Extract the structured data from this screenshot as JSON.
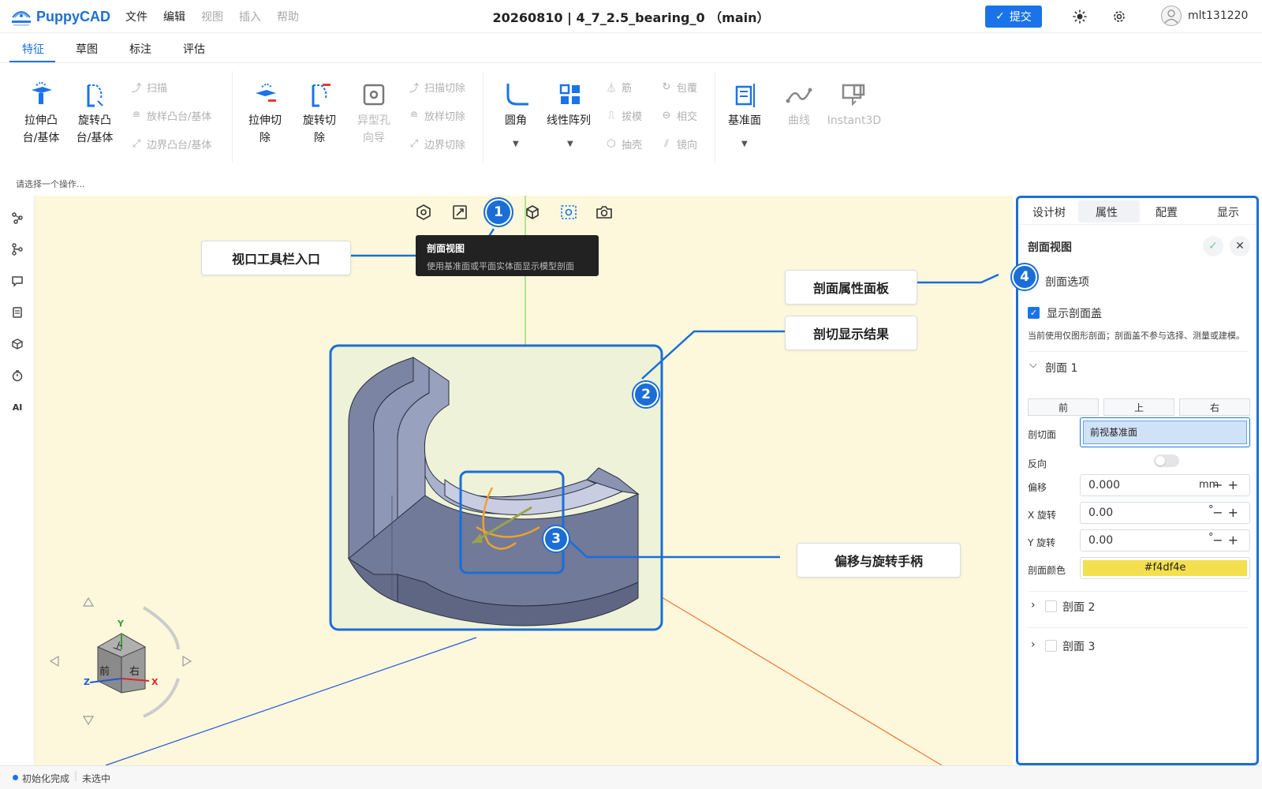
{
  "app": {
    "name": "PuppyCAD",
    "document_title": "20260810 | 4_7_2.5_bearing_0 （main）"
  },
  "menu": [
    {
      "label": "文件",
      "enabled": true
    },
    {
      "label": "编辑",
      "enabled": true
    },
    {
      "label": "视图",
      "enabled": false
    },
    {
      "label": "插入",
      "enabled": false
    },
    {
      "label": "帮助",
      "enabled": false
    }
  ],
  "header": {
    "submit_label": "提交",
    "username": "mlt131220",
    "icons": [
      "sun-icon",
      "gear-icon",
      "avatar-icon"
    ]
  },
  "tabs": [
    {
      "label": "特征",
      "active": true
    },
    {
      "label": "草图",
      "active": false
    },
    {
      "label": "标注",
      "active": false
    },
    {
      "label": "评估",
      "active": false
    }
  ],
  "ribbon": {
    "extrude_boss": "拉伸凸\n台/基体",
    "extrude_boss_l1": "拉伸凸",
    "extrude_boss_l2": "台/基体",
    "revolve_boss_l1": "旋转凸",
    "revolve_boss_l2": "台/基体",
    "sweep": "扫描",
    "loft_boss": "放样凸台/基体",
    "boundary_boss": "边界凸台/基体",
    "extrude_cut_l1": "拉伸切",
    "extrude_cut_l2": "除",
    "revolve_cut_l1": "旋转切",
    "revolve_cut_l2": "除",
    "hole_wizard_l1": "异型孔",
    "hole_wizard_l2": "向导",
    "sweep_cut": "扫描切除",
    "loft_cut": "放样切除",
    "boundary_cut": "边界切除",
    "fillet": "圆角",
    "linear_pattern": "线性阵列",
    "rib": "筋",
    "draft": "拔模",
    "shell": "抽壳",
    "wrap": "包覆",
    "intersect": "相交",
    "mirror": "镜向",
    "ref_plane": "基准面",
    "curve": "曲线",
    "instant3d": "Instant3D"
  },
  "hint": "请选择一个操作...",
  "left_sidebar": {
    "icons": [
      "feature-tree-icon",
      "branch-icon",
      "comment-icon",
      "document-list-icon",
      "cube-icon",
      "timer-icon",
      "ai-icon"
    ],
    "ai_label": "AI"
  },
  "viewport_toolbar": {
    "icons": [
      "display-style-icon",
      "fit-view-icon",
      "section-view-icon",
      "view-cube-icon",
      "screenshot-region-icon",
      "camera-icon"
    ]
  },
  "tooltip": {
    "title": "剖面视图",
    "desc": "使用基准面或平面实体面显示模型剖面"
  },
  "callouts": {
    "c1_label": "视口工具栏入口",
    "c1_num": "1",
    "c2_label": "剖切显示结果",
    "c2_num": "2",
    "c3_label": "偏移与旋转手柄",
    "c3_num": "3",
    "c4_label": "剖面属性面板",
    "c4_num": "4"
  },
  "view_cube": {
    "top": "上",
    "front": "前",
    "right": "右",
    "axis_x": "X",
    "axis_y": "Y",
    "axis_z": "Z"
  },
  "right_panel": {
    "tabs": [
      {
        "label": "设计树",
        "active": false
      },
      {
        "label": "属性",
        "active": true
      },
      {
        "label": "配置",
        "active": false
      },
      {
        "label": "显示",
        "active": false
      }
    ],
    "title": "剖面视图",
    "section_options": "剖面选项",
    "show_cap_label": "显示剖面盖",
    "show_cap_checked": true,
    "note": "当前使用仅图形剖面；剖面盖不参与选择、测量或建模。",
    "section1_label": "剖面 1",
    "plane_buttons": [
      "前",
      "上",
      "右"
    ],
    "cut_plane_label": "剖切面",
    "cut_plane_value": "前视基准面",
    "reverse_label": "反向",
    "reverse_on": false,
    "offset_label": "偏移",
    "offset_value": "0.000",
    "offset_unit": "mm",
    "x_rot_label": "X 旋转",
    "x_rot_value": "0.00",
    "y_rot_label": "Y 旋转",
    "y_rot_value": "0.00",
    "rot_unit": "°",
    "pm": "−+",
    "color_label": "剖面颜色",
    "color_value": "#f4df4e",
    "section2_label": "剖面 2",
    "section3_label": "剖面 3"
  },
  "status": {
    "init": "初始化完成",
    "selection": "未选中"
  },
  "colors": {
    "accent": "#1a73e8",
    "viewport_bg": "#fdf8dc",
    "section_color": "#f4df4e",
    "callout_blue": "#1a6ed6"
  }
}
